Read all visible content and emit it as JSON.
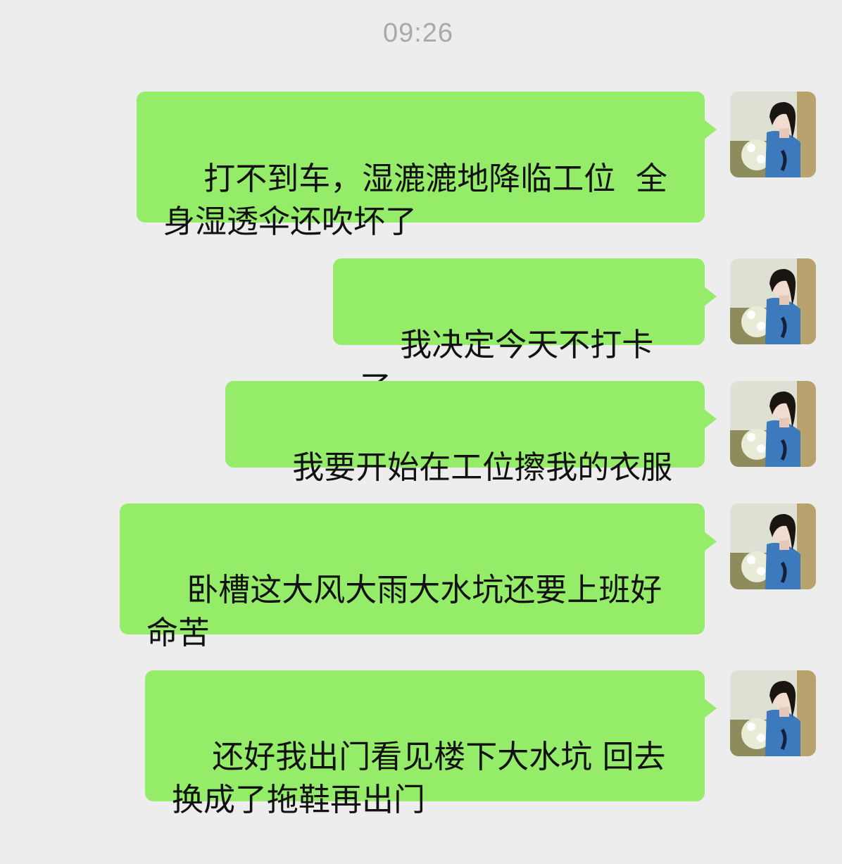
{
  "timestamp": "09:26",
  "messages": [
    {
      "text": "打不到车，湿漉漉地降临工位  全身湿透伞还吹坏了"
    },
    {
      "text": "我决定今天不打卡了"
    },
    {
      "text": "我要开始在工位擦我的衣服"
    },
    {
      "text": "卧槽这大风大雨大水坑还要上班好命苦"
    },
    {
      "text": "还好我出门看见楼下大水坑 回去换成了拖鞋再出门"
    }
  ],
  "avatar": {
    "icon": "user-avatar-photo"
  },
  "colors": {
    "background": "#ededed",
    "bubble": "#95ec69",
    "timestamp": "#a9a9a9"
  }
}
